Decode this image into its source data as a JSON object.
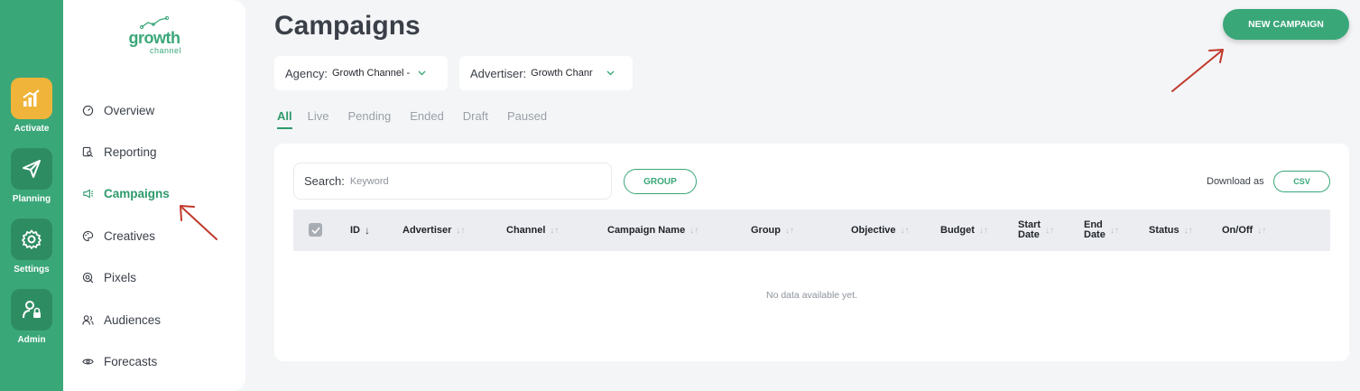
{
  "rail": {
    "items": [
      {
        "label": "Activate",
        "icon": "activate-chart-icon",
        "active": true
      },
      {
        "label": "Planning",
        "icon": "paper-plane-icon",
        "active": false
      },
      {
        "label": "Settings",
        "icon": "gear-icon",
        "active": false
      },
      {
        "label": "Admin",
        "icon": "user-lock-icon",
        "active": false
      }
    ]
  },
  "logo": {
    "word": "growth",
    "sub": "channel"
  },
  "nav": {
    "items": [
      {
        "label": "Overview",
        "icon": "gauge-icon"
      },
      {
        "label": "Reporting",
        "icon": "report-search-icon"
      },
      {
        "label": "Campaigns",
        "icon": "megaphone-icon",
        "active": true
      },
      {
        "label": "Creatives",
        "icon": "palette-icon"
      },
      {
        "label": "Pixels",
        "icon": "pixel-target-icon"
      },
      {
        "label": "Audiences",
        "icon": "users-icon"
      },
      {
        "label": "Forecasts",
        "icon": "eye-icon"
      }
    ]
  },
  "header": {
    "title": "Campaigns",
    "new_campaign_label": "NEW CAMPAIGN"
  },
  "filters": {
    "agency": {
      "label": "Agency:",
      "value": "Growth Channel -"
    },
    "advertiser": {
      "label": "Advertiser:",
      "value": "Growth Chanr"
    }
  },
  "tabs": [
    "All",
    "Live",
    "Pending",
    "Ended",
    "Draft",
    "Paused"
  ],
  "toolbar": {
    "search_label": "Search:",
    "search_placeholder": "Keyword",
    "group_label": "GROUP",
    "download_label": "Download as",
    "csv_label": "CSV"
  },
  "table": {
    "columns": [
      {
        "label": "ID",
        "sort": "desc"
      },
      {
        "label": "Advertiser"
      },
      {
        "label": "Channel"
      },
      {
        "label": "Campaign Name"
      },
      {
        "label": "Group"
      },
      {
        "label": "Objective"
      },
      {
        "label": "Budget"
      },
      {
        "label": "Start Date",
        "line1": "Start",
        "line2": "Date"
      },
      {
        "label": "End Date",
        "line1": "End",
        "line2": "Date"
      },
      {
        "label": "Status"
      },
      {
        "label": "On/Off"
      }
    ],
    "empty_message": "No data available yet.",
    "sort_glyph": "↓↑",
    "sort_active_glyph": "↓"
  },
  "colors": {
    "brand_green": "#3aa779",
    "active_orange": "#f0b43a",
    "annotation_red": "#c0392b"
  }
}
